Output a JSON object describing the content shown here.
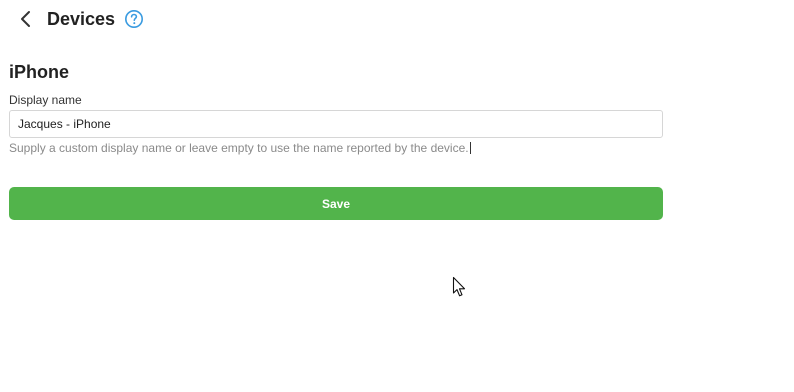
{
  "header": {
    "title": "Devices",
    "back_icon": "chevron-left-icon",
    "help_icon": "question-circle-icon",
    "help_icon_color": "#3a9be0"
  },
  "device": {
    "name": "iPhone"
  },
  "form": {
    "display_name_label": "Display name",
    "display_name_value": "Jacques - iPhone",
    "display_name_help": "Supply a custom display name or leave empty to use the name reported by the device.",
    "save_label": "Save"
  },
  "colors": {
    "save_button_bg": "#52b44b",
    "input_border": "#d6d6d6",
    "help_text": "#8a8a8a"
  }
}
